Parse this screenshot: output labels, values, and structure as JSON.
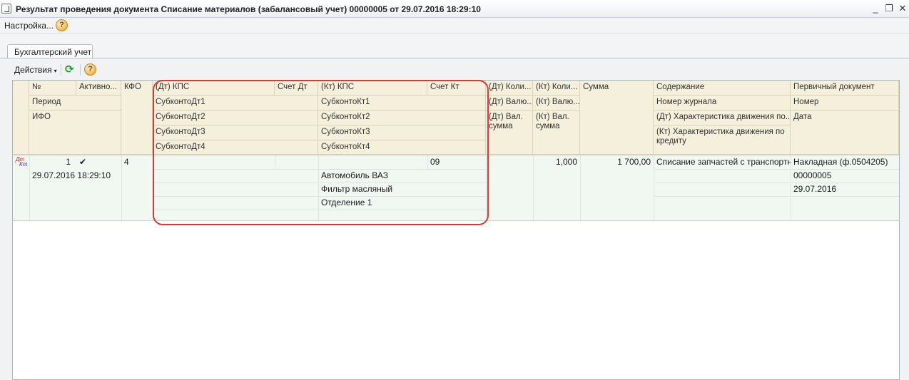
{
  "window": {
    "title": "Результат проведения документа Списание материалов (забалансовый учет) 00000005 от 29.07.2016 18:29:10",
    "minimize_icon": "minimize-icon",
    "restore_icon": "restore-icon",
    "close_icon": "close-icon"
  },
  "menu": {
    "settings_label": "Настройка...",
    "help_label": "?"
  },
  "tabs": [
    {
      "label": "Бухгалтерский учет"
    }
  ],
  "toolbar": {
    "actions_label": "Действия",
    "caret": "▾",
    "refresh_glyph": "⟳",
    "help_label": "?"
  },
  "grid": {
    "headers": {
      "number": "№",
      "active": "Активно...",
      "kfo": "КФО",
      "dt_kps": "(Дт) КПС",
      "account_dt": "Счет Дт",
      "kt_kps": "(Кт) КПС",
      "account_kt": "Счет Кт",
      "dt_qty": "(Дт) Коли...",
      "kt_qty": "(Кт) Коли...",
      "amount": "Сумма",
      "content": "Содержание",
      "primary_doc": "Первичный документ",
      "period": "Период",
      "subconto_dt1": "СубконтоДт1",
      "subconto_kt1": "СубконтоКт1",
      "dt_currency": "(Дт) Валю...",
      "kt_currency": "(Кт) Валю...",
      "journal_no": "Номер журнала",
      "doc_number": "Номер",
      "ifo": "ИФО",
      "subconto_dt2": "СубконтоДт2",
      "subconto_kt2": "СубконтоКт2",
      "dt_cur_amount": "(Дт) Вал. сумма",
      "kt_cur_amount": "(Кт) Вал. сумма",
      "dt_movement": "(Дт) Характеристика движения по...",
      "doc_date": "Дата",
      "subconto_dt3": "СубконтоДт3",
      "subconto_kt3": "СубконтоКт3",
      "kt_movement": "(Кт) Характеристика движения по кредиту",
      "subconto_dt4": "СубконтоДт4",
      "subconto_kt4": "СубконтоКт4"
    },
    "rows": [
      {
        "type_icon_dt": "Дт",
        "type_icon_kt": "Кт",
        "number": "1",
        "active_mark": "✔",
        "kfo": "4",
        "account_kt": "09",
        "kt_qty": "1,000",
        "amount": "1 700,00",
        "content": "Списание запчастей с транспортн...",
        "primary_doc": "Накладная (ф.0504205)",
        "period": "29.07.2016 18:29:10",
        "subconto_kt1": "Автомобиль ВАЗ",
        "doc_number": "00000005",
        "subconto_kt2": "Фильтр масляный",
        "doc_date": "29.07.2016",
        "subconto_kt3": "Отделение 1"
      }
    ]
  }
}
